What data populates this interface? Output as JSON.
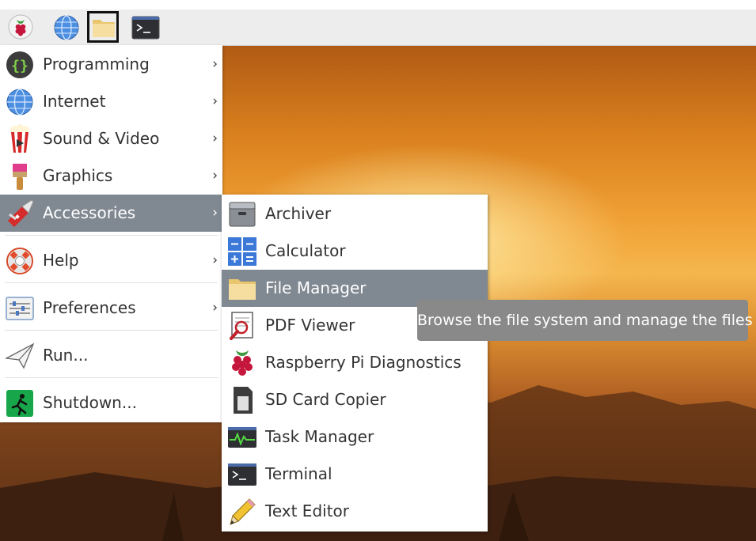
{
  "taskbar": {
    "buttons": [
      {
        "name": "raspberry-menu-button",
        "icon": "raspberry-pi-logo-icon"
      },
      {
        "name": "web-browser-button",
        "icon": "globe-icon"
      },
      {
        "name": "file-manager-button",
        "icon": "folder-icon",
        "active": true
      },
      {
        "name": "terminal-button",
        "icon": "terminal-icon"
      }
    ]
  },
  "menu": {
    "items": [
      {
        "label": "Programming",
        "arrow": "›",
        "icon": "programming-icon"
      },
      {
        "label": "Internet",
        "arrow": "›",
        "icon": "globe-icon"
      },
      {
        "label": "Sound & Video",
        "arrow": "›",
        "icon": "popcorn-icon"
      },
      {
        "label": "Graphics",
        "arrow": "›",
        "icon": "paintbrush-icon"
      },
      {
        "label": "Accessories",
        "arrow": "›",
        "icon": "swiss-knife-icon",
        "selected": true
      },
      {
        "label": "Help",
        "arrow": "›",
        "icon": "lifebuoy-icon"
      },
      {
        "label": "Preferences",
        "arrow": "›",
        "icon": "preferences-icon"
      },
      {
        "label": "Run...",
        "icon": "paper-plane-icon"
      },
      {
        "label": "Shutdown...",
        "icon": "exit-icon"
      }
    ]
  },
  "submenu": {
    "items": [
      {
        "label": "Archiver",
        "icon": "archive-icon"
      },
      {
        "label": "Calculator",
        "icon": "calculator-icon"
      },
      {
        "label": "File Manager",
        "icon": "folder-icon",
        "selected": true
      },
      {
        "label": "PDF Viewer",
        "icon": "pdf-viewer-icon"
      },
      {
        "label": "Raspberry Pi Diagnostics",
        "icon": "raspberry-icon"
      },
      {
        "label": "SD Card Copier",
        "icon": "sd-card-icon"
      },
      {
        "label": "Task Manager",
        "icon": "task-manager-icon"
      },
      {
        "label": "Terminal",
        "icon": "terminal-icon"
      },
      {
        "label": "Text Editor",
        "icon": "pencil-icon"
      }
    ]
  },
  "tooltip": {
    "text": "Browse the file system and manage the files"
  },
  "colors": {
    "selection": "#808891",
    "tooltip_bg": "#898989",
    "taskbar_bg": "#ededed"
  }
}
